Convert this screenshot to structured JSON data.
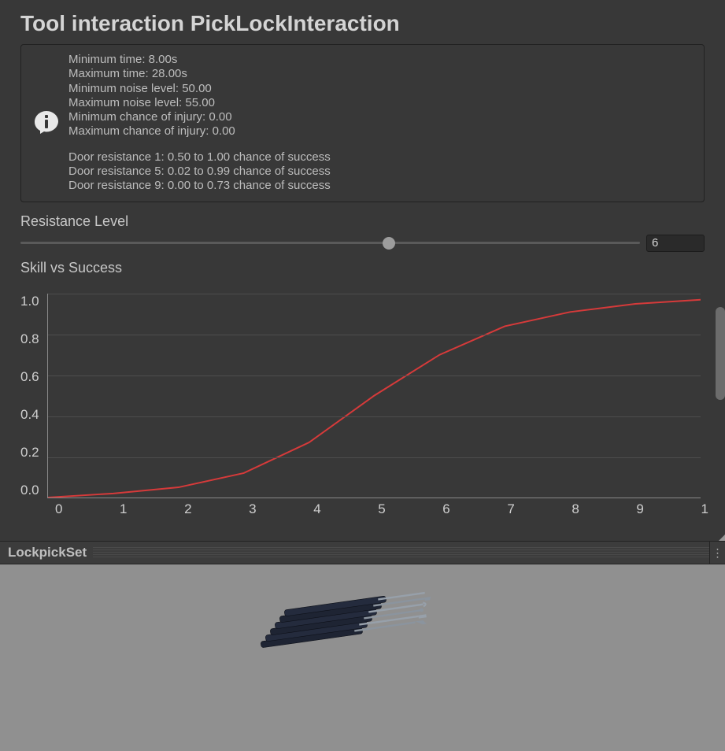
{
  "header": {
    "title": "Tool interaction PickLockInteraction"
  },
  "info": {
    "lines": [
      "Minimum time: 8.00s",
      "Maximum time: 28.00s",
      "Minimum noise level: 50.00",
      "Maximum noise level: 55.00",
      "Minimum chance of injury: 0.00",
      "Maximum chance of injury: 0.00"
    ],
    "lines2": [
      "Door resistance 1: 0.50 to 1.00 chance of success",
      "Door resistance 5: 0.02 to 0.99 chance of success",
      "Door resistance 9: 0.00 to 0.73 chance of success"
    ]
  },
  "resistance": {
    "label": "Resistance Level",
    "value": "6",
    "min": 1,
    "max": 10,
    "fraction": 0.595
  },
  "chart": {
    "label": "Skill vs Success"
  },
  "chart_data": {
    "type": "line",
    "title": "Skill vs Success",
    "xlabel": "",
    "ylabel": "",
    "xlim": [
      0,
      10
    ],
    "ylim": [
      0,
      1.0
    ],
    "xticks": [
      "0",
      "1",
      "2",
      "3",
      "4",
      "5",
      "6",
      "7",
      "8",
      "9",
      "1"
    ],
    "yticks": [
      "1.0",
      "0.8",
      "0.6",
      "0.4",
      "0.2",
      "0.0"
    ],
    "series": [
      {
        "name": "success",
        "color": "#d63a3a",
        "x": [
          0,
          1,
          2,
          3,
          4,
          5,
          6,
          7,
          8,
          9,
          10
        ],
        "values": [
          0.0,
          0.02,
          0.05,
          0.12,
          0.27,
          0.5,
          0.7,
          0.84,
          0.91,
          0.95,
          0.97
        ]
      }
    ]
  },
  "preview": {
    "label": "LockpickSet"
  }
}
